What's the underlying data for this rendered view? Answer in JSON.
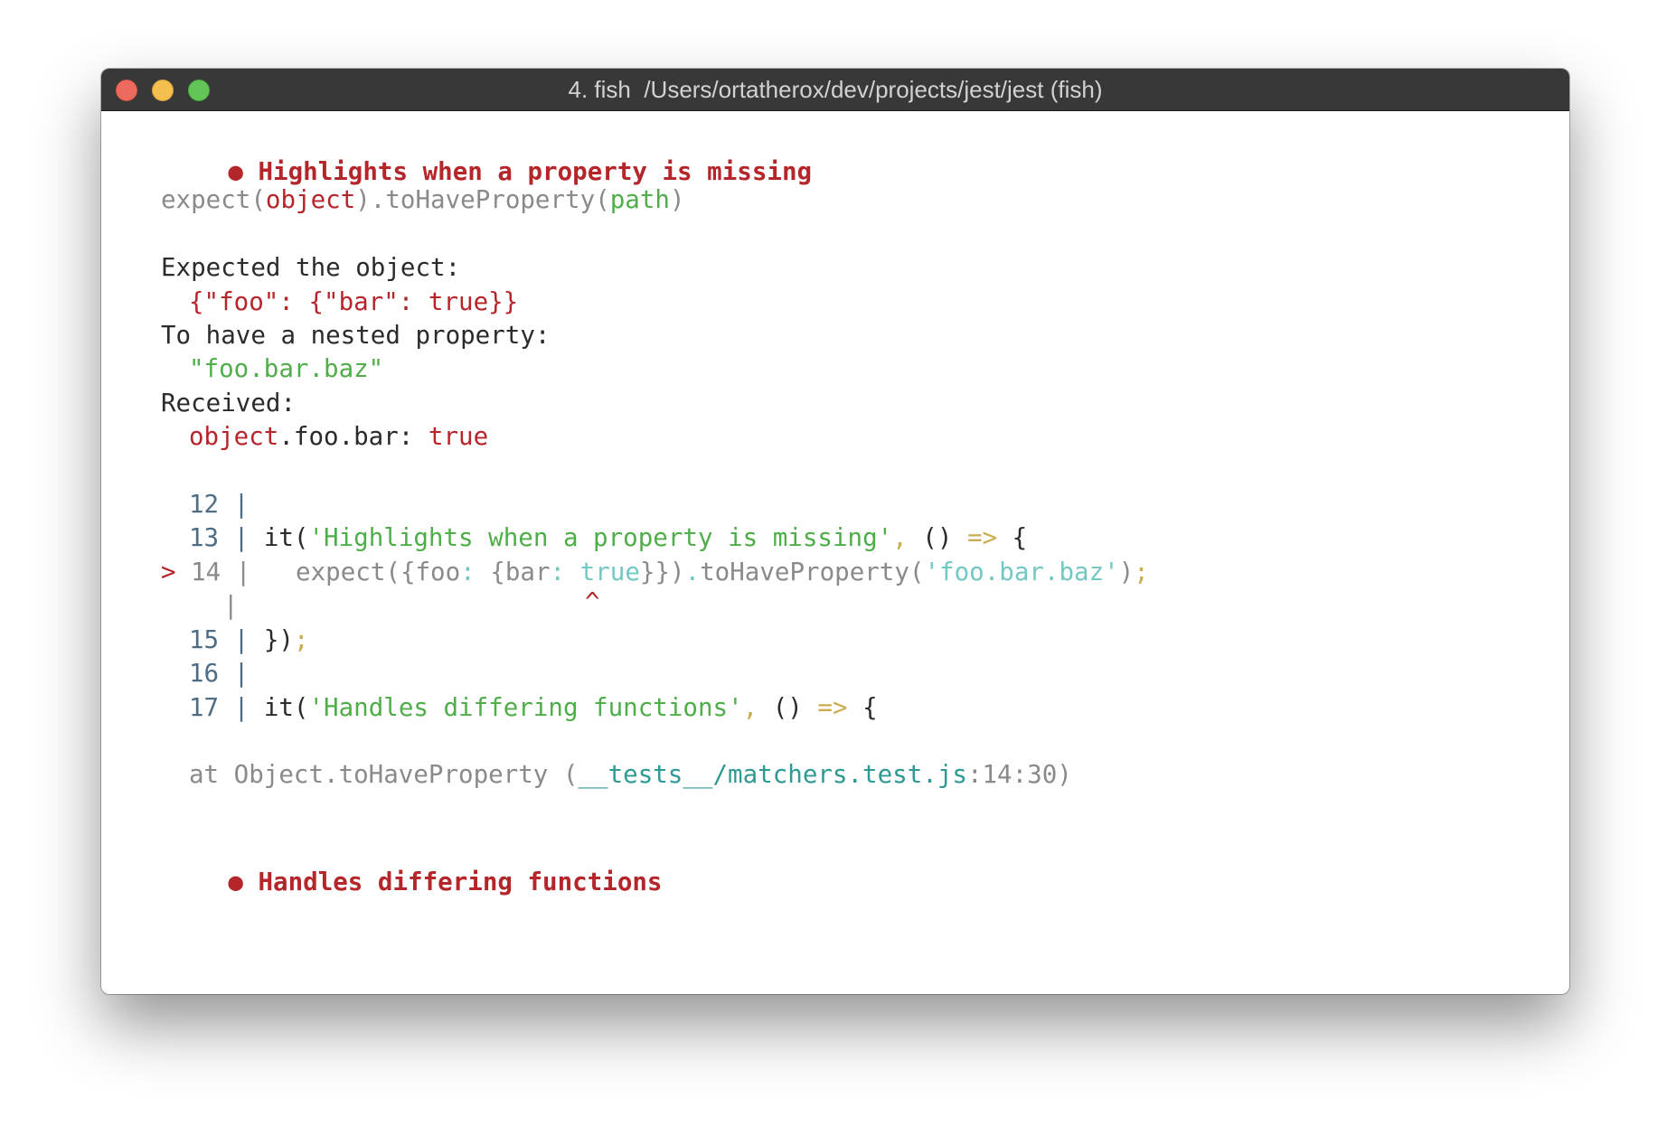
{
  "window": {
    "title": "4. fish  /Users/ortatherox/dev/projects/jest/jest (fish)"
  },
  "test1": {
    "bullet": "●",
    "name": "Highlights when a property is missing"
  },
  "matcher": {
    "expect": "expect(",
    "object": "object",
    "mid": ").toHaveProperty(",
    "path": "path",
    "close": ")"
  },
  "message": {
    "expected_label": "Expected the object:",
    "expected_value": "{\"foo\": {\"bar\": true}}",
    "nested_label": "To have a nested property:",
    "nested_value": "\"foo.bar.baz\"",
    "received_label": "Received:",
    "received_object": "object",
    "received_path": ".foo.bar: ",
    "received_value": "true"
  },
  "code_frame": {
    "gutter": "|",
    "marker": ">",
    "caret": "^",
    "lines": [
      {
        "num": "12"
      },
      {
        "num": "13",
        "it": "it(",
        "str": "'Highlights when a property is missing'",
        "comma": ",",
        "args": " () ",
        "arrow": "=>",
        "brace": " {"
      },
      {
        "num": "14",
        "expect": "expect({foo",
        "c1": ":",
        "bar": " {bar",
        "c2": ":",
        "true_val": " true",
        "closing": "}})",
        "dot": ".",
        "method": "toHaveProperty(",
        "str": "'foo.bar.baz'",
        "paren": ")",
        "semi": ";"
      },
      {
        "num": "15",
        "close": "})",
        "semi": ";"
      },
      {
        "num": "16"
      },
      {
        "num": "17",
        "it": "it(",
        "str": "'Handles differing functions'",
        "comma": ",",
        "args": " () ",
        "arrow": "=>",
        "brace": " {"
      }
    ]
  },
  "stack": {
    "at": "at Object.toHaveProperty (",
    "file": "__tests__/matchers.test.js",
    "loc": ":14:30)"
  },
  "test2": {
    "bullet": "●",
    "name": "Handles differing functions"
  }
}
